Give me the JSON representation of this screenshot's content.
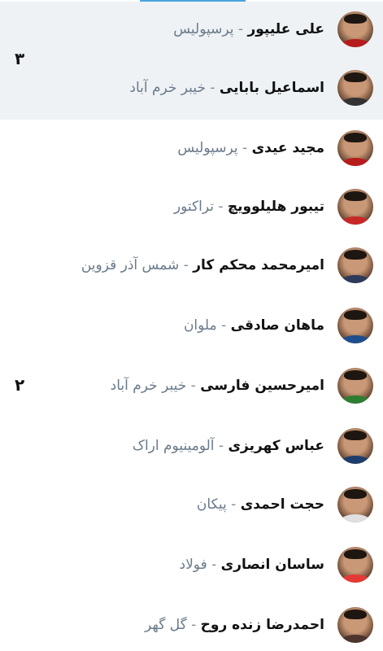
{
  "groups": [
    {
      "rank": "۳"
    },
    {
      "rank": "۲"
    }
  ],
  "separator": "-",
  "players": [
    {
      "name": "علی علیپور",
      "team": "پرسپولیس",
      "shirt": "#b71c1c"
    },
    {
      "name": "اسماعیل بابایی",
      "team": "خیبر خرم آباد",
      "shirt": "#333333"
    },
    {
      "name": "مجید عیدی",
      "team": "پرسپولیس",
      "shirt": "#b71c1c"
    },
    {
      "name": "تیبور هلیلوویچ",
      "team": "تراکتور",
      "shirt": "#c62828"
    },
    {
      "name": "امیرمحمد محکم کار",
      "team": "شمس آذر قزوین",
      "shirt": "#2e3a59"
    },
    {
      "name": "ماهان صادقی",
      "team": "ملوان",
      "shirt": "#1f4e8c"
    },
    {
      "name": "امیرحسین فارسی",
      "team": "خیبر خرم آباد",
      "shirt": "#2e7d32"
    },
    {
      "name": "عباس کهریزی",
      "team": "آلومینیوم اراک",
      "shirt": "#1e3d6b"
    },
    {
      "name": "حجت احمدی",
      "team": "پیکان",
      "shirt": "#e0e0e0"
    },
    {
      "name": "ساسان انصاری",
      "team": "فولاد",
      "shirt": "#e53935"
    },
    {
      "name": "احمدرضا زنده روح",
      "team": "گل گهر",
      "shirt": "#4e342e"
    }
  ]
}
